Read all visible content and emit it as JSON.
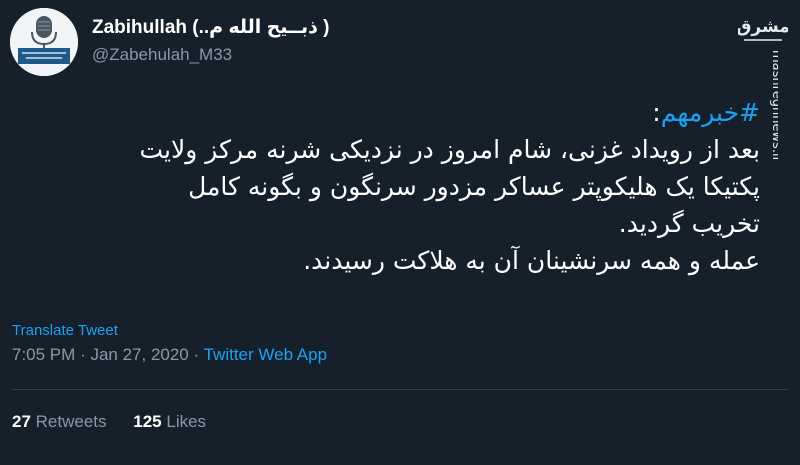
{
  "author": {
    "display_name": "Zabihullah (..ذبــیح الله م )",
    "handle": "@Zabehulah_M33",
    "avatar_icon": "podcast-microphone-icon"
  },
  "watermark": {
    "logo_text": "مشرق",
    "url_text": "mashreghnews.ir"
  },
  "tweet": {
    "hashtag": "#خبرمهم",
    "hashtag_suffix": ":",
    "lines": [
      "بعد از رویداد غزنی، شام امروز در نزدیکی شرنه مرکز ولایت",
      "پکتیکا یک هلیکوپتر عساکر مزدور سرنگون و بگونه کامل",
      "تخریب گردید.",
      "عمله و همه سرنشینان آن به هلاکت رسیدند."
    ]
  },
  "translate_label": "Translate Tweet",
  "meta": {
    "time": "7:05 PM",
    "separator": "·",
    "date": "Jan 27, 2020",
    "source": "Twitter Web App"
  },
  "stats": {
    "retweets_count": "27",
    "retweets_label": "Retweets",
    "likes_count": "125",
    "likes_label": "Likes"
  },
  "colors": {
    "background": "#15202b",
    "text": "#ffffff",
    "secondary": "#8899a6",
    "accent": "#1da1f2",
    "divider": "#38444d"
  }
}
